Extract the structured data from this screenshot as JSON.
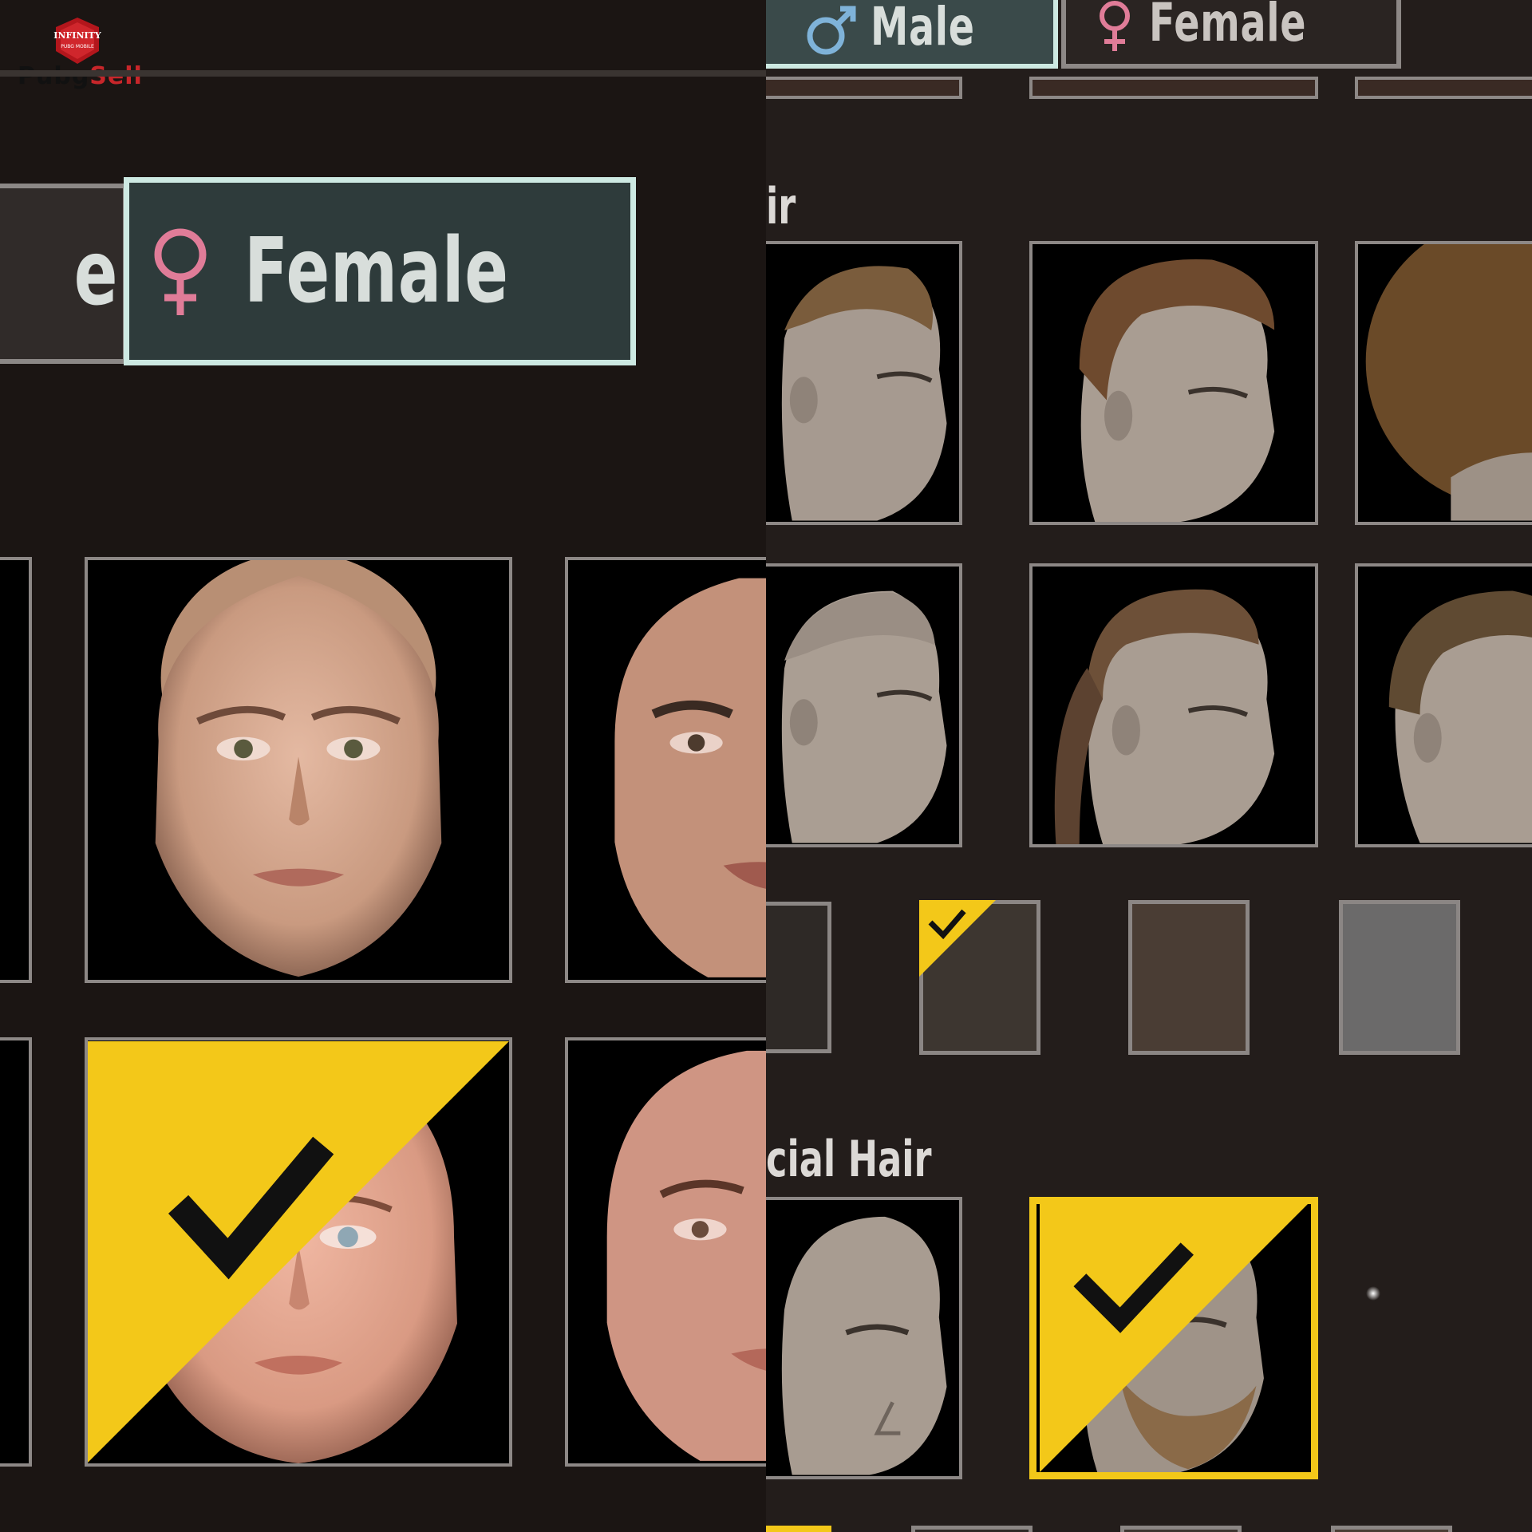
{
  "logo": {
    "top_line": "INFINITY",
    "sub_line": "PUBG MOBILE",
    "wordmark_pubg": "Pubg",
    "wordmark_sell": "Sell"
  },
  "left_panel": {
    "gender_tabs": [
      {
        "label": "e",
        "icon": "male-symbol-icon",
        "selected": false
      },
      {
        "label": "Female",
        "icon": "female-symbol-icon",
        "selected": true
      }
    ],
    "faces": [
      {
        "name": "face-1",
        "selected": false
      },
      {
        "name": "face-2",
        "selected": false
      },
      {
        "name": "face-3",
        "selected": true
      },
      {
        "name": "face-4",
        "selected": false
      }
    ]
  },
  "right_panel": {
    "gender_tabs": [
      {
        "label": "Male",
        "icon": "male-symbol-icon",
        "selected": true
      },
      {
        "label": "Female",
        "icon": "female-symbol-icon",
        "selected": false
      }
    ],
    "hair_section_title": "ir",
    "hairstyles": [
      {
        "name": "undercut",
        "selected": false
      },
      {
        "name": "side-sweep",
        "selected": false
      },
      {
        "name": "afro",
        "selected": false
      },
      {
        "name": "buzz",
        "selected": false
      },
      {
        "name": "ponytail",
        "selected": false
      },
      {
        "name": "short-curls",
        "selected": false
      }
    ],
    "hair_colors": [
      {
        "hex": "#2e2926",
        "selected": false
      },
      {
        "hex": "#3d3630",
        "selected": true
      },
      {
        "hex": "#4a3d34",
        "selected": false
      },
      {
        "hex": "#6b6a6a",
        "selected": false
      }
    ],
    "facial_hair_section_title": "cial Hair",
    "facial_hair": [
      {
        "name": "none",
        "selected": false
      },
      {
        "name": "full-beard",
        "selected": true
      }
    ]
  },
  "colors": {
    "tab_selected_border": "#cde9e2",
    "selection_yellow": "#f3c819",
    "male_symbol": "#7fb3d9",
    "female_symbol": "#e07c98"
  }
}
